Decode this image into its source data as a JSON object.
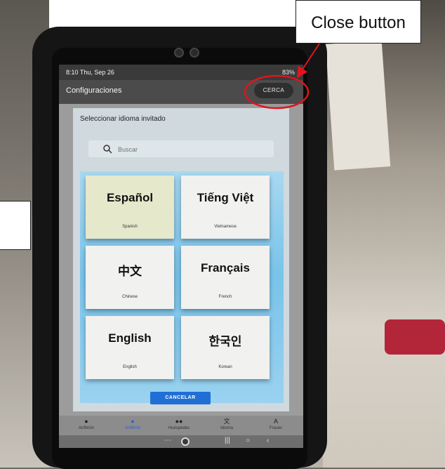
{
  "annotation": {
    "label": "Close button"
  },
  "status_bar": {
    "time": "8:10 Thu, Sep 26",
    "battery": "83%"
  },
  "app_bar": {
    "title": "Configuraciones",
    "close_button_label": "CERCA"
  },
  "dialog": {
    "title": "Seleccionar idioma invitado",
    "search_placeholder": "Buscar",
    "languages": [
      {
        "name": "Español",
        "subtitle": "Spanish",
        "selected": true
      },
      {
        "name": "Tiếng Việt",
        "subtitle": "Vietnamese",
        "selected": false
      },
      {
        "name": "中文",
        "subtitle": "Chinese",
        "selected": false
      },
      {
        "name": "Français",
        "subtitle": "French",
        "selected": false
      },
      {
        "name": "English",
        "subtitle": "English",
        "selected": false
      },
      {
        "name": "한국인",
        "subtitle": "Korean",
        "selected": false
      }
    ],
    "cancel_label": "CANCELAR"
  },
  "bottom_nav": [
    {
      "label": "Anfitrión",
      "icon": "person-icon"
    },
    {
      "label": "Anfitrión",
      "icon": "person-icon",
      "active": true
    },
    {
      "label": "Huéspedes",
      "icon": "group-icon"
    },
    {
      "label": "Idioma",
      "icon": "translate-icon"
    },
    {
      "label": "Frases",
      "icon": "text-size-icon"
    }
  ],
  "colors": {
    "accent_blue": "#1f6fd6",
    "annotation_red": "#e0141e"
  }
}
